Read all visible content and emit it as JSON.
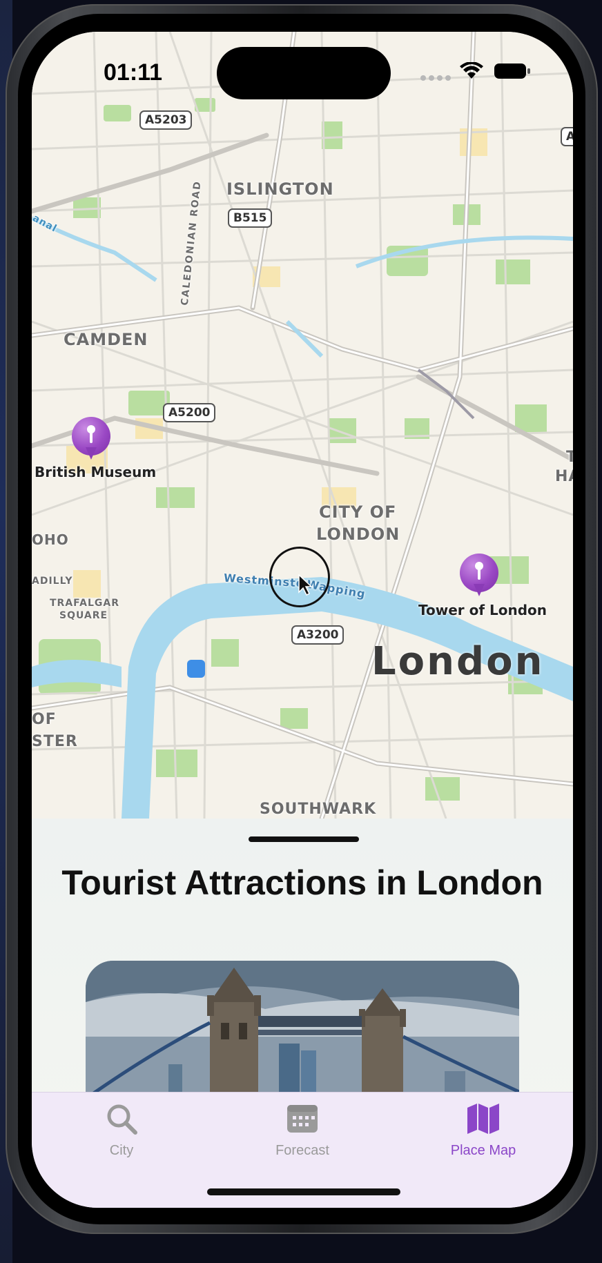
{
  "status_bar": {
    "time": "01:11"
  },
  "map": {
    "areas": [
      "ISLINGTON",
      "CAMDEN",
      "CITY OF",
      "LONDON",
      "SOUTHWARK",
      "OHO",
      "ADILLY",
      "TRAFALGAR",
      "SQUARE",
      "OF",
      "STER",
      "T",
      "HA"
    ],
    "roads": [
      "A5203",
      "B515",
      "A5200",
      "A3200",
      "A",
      "CALEDONIAN ROAD",
      "anal"
    ],
    "water_labels": [
      "Westminster",
      "Wapping"
    ],
    "city_label": "London",
    "pins": [
      {
        "name": "British Museum"
      },
      {
        "name": "Tower of London"
      }
    ],
    "water_color": "#a8d8ee",
    "park_color": "#b9dea0",
    "pin_color": "#9a48c4"
  },
  "sheet": {
    "title": "Tourist Attractions in London"
  },
  "tabs": [
    {
      "label": "City",
      "icon": "search-icon",
      "active": false
    },
    {
      "label": "Forecast",
      "icon": "calendar-icon",
      "active": false
    },
    {
      "label": "Place Map",
      "icon": "map-icon",
      "active": true
    }
  ],
  "accent_color": "#8b46c8"
}
